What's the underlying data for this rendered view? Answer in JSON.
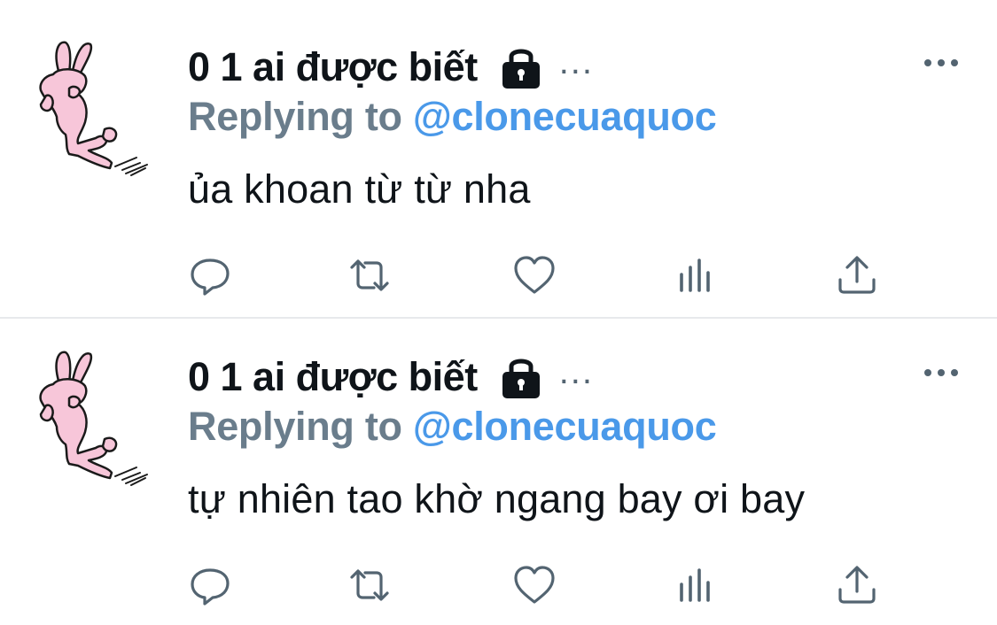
{
  "tweets": [
    {
      "display_name": "0 1 ai được biết",
      "name_trailing": "...",
      "replying_label": "Replying to",
      "reply_handle": "@clonecuaquoc",
      "text": "ủa khoan từ từ nha"
    },
    {
      "display_name": "0 1 ai được biết",
      "name_trailing": "...",
      "replying_label": "Replying to",
      "reply_handle": "@clonecuaquoc",
      "text": "tự nhiên tao khờ ngang bay ơi bay"
    }
  ],
  "icons": {
    "avatar": "pink-rabbit-avatar",
    "lock": "lock-icon",
    "more": "more-options-icon",
    "reply": "reply-icon",
    "retweet": "retweet-icon",
    "like": "like-heart-icon",
    "stats": "analytics-icon",
    "share": "share-icon"
  },
  "colors": {
    "text": "#0f1419",
    "secondary": "#6a7d8c",
    "link": "#4a99e9",
    "icon": "#536471",
    "divider": "#e7e9ec",
    "avatar_pink": "#f7c6d9"
  }
}
